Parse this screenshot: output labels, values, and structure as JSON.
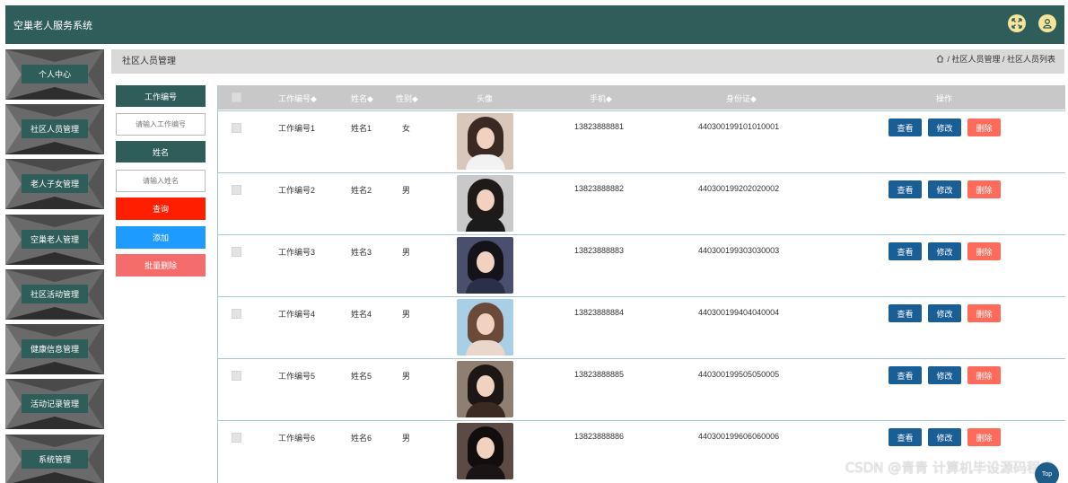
{
  "app": {
    "title": "空巢老人服务系统"
  },
  "header_icons": [
    "fullscreen-icon",
    "user-icon"
  ],
  "colors": {
    "primary": "#2f5d5a",
    "danger": "#ff1f00",
    "add": "#1e9bff",
    "batch_delete": "#f56c6c",
    "action_blue": "#1a5e96",
    "delete_btn": "#ff6b5b"
  },
  "sidebar": {
    "items": [
      {
        "label": "个人中心"
      },
      {
        "label": "社区人员管理"
      },
      {
        "label": "老人子女管理"
      },
      {
        "label": "空巢老人管理"
      },
      {
        "label": "社区活动管理"
      },
      {
        "label": "健康信息管理"
      },
      {
        "label": "活动记录管理"
      },
      {
        "label": "系统管理"
      }
    ]
  },
  "content": {
    "title": "社区人员管理",
    "breadcrumb": "/ 社区人员管理 / 社区人员列表"
  },
  "search": {
    "label_worker_no": "工作编号",
    "placeholder_worker_no": "请输入工作编号",
    "label_name": "姓名",
    "placeholder_name": "请输入姓名",
    "query_button": "查询",
    "add_button": "添加",
    "batch_delete_button": "批量删除"
  },
  "table": {
    "headers": [
      "工作编号◆",
      "姓名◆",
      "性别◆",
      "头像",
      "手机◆",
      "身份证◆",
      "操作"
    ],
    "actions": {
      "view": "查看",
      "edit": "修改",
      "delete": "删除"
    },
    "rows": [
      {
        "worker_no": "工作编号1",
        "name": "姓名1",
        "gender": "女",
        "phone": "13823888881",
        "id_card": "440300199101010001"
      },
      {
        "worker_no": "工作编号2",
        "name": "姓名2",
        "gender": "男",
        "phone": "13823888882",
        "id_card": "440300199202020002"
      },
      {
        "worker_no": "工作编号3",
        "name": "姓名3",
        "gender": "男",
        "phone": "13823888883",
        "id_card": "440300199303030003"
      },
      {
        "worker_no": "工作编号4",
        "name": "姓名4",
        "gender": "男",
        "phone": "13823888884",
        "id_card": "440300199404040004"
      },
      {
        "worker_no": "工作编号5",
        "name": "姓名5",
        "gender": "男",
        "phone": "13823888885",
        "id_card": "440300199505050005"
      },
      {
        "worker_no": "工作编号6",
        "name": "姓名6",
        "gender": "男",
        "phone": "13823888886",
        "id_card": "440300199606060006"
      }
    ]
  },
  "watermark": "CSDN @青青  计算机毕设源码程序",
  "back_to_top": "Top"
}
